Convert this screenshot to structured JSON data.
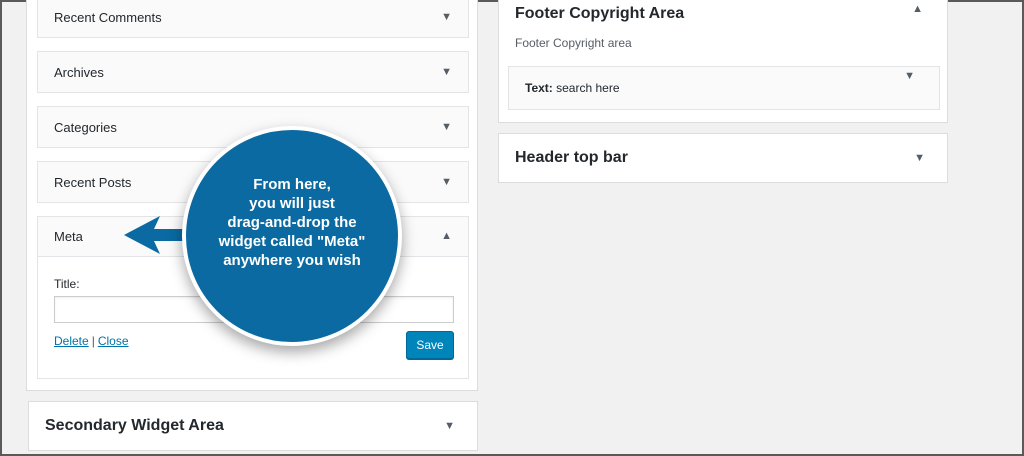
{
  "sidebar_widgets": [
    {
      "label": "Recent Comments",
      "arrow": "▼"
    },
    {
      "label": "Archives",
      "arrow": "▼"
    },
    {
      "label": "Categories",
      "arrow": "▼"
    },
    {
      "label": "Recent Posts",
      "arrow": "▼"
    }
  ],
  "meta_widget": {
    "label": "Meta",
    "arrow": "▲",
    "title_label": "Title:",
    "title_value": "",
    "delete_label": "Delete",
    "separator": "|",
    "close_label": "Close",
    "save_label": "Save"
  },
  "secondary_area": {
    "title": "Secondary Widget Area",
    "arrow": "▼"
  },
  "footer_area": {
    "title": "Footer Copyright Area",
    "arrow": "▲",
    "description": "Footer Copyright area",
    "text_widget": {
      "prefix": "Text:",
      "name": "search here",
      "arrow": "▼"
    }
  },
  "header_bar": {
    "title": "Header top bar",
    "arrow": "▼"
  },
  "callout": {
    "lines": [
      "From here,",
      "you will just",
      "drag-and-drop the",
      "widget called \"Meta\"",
      "anywhere you wish"
    ],
    "color": "#0a6aa1"
  }
}
